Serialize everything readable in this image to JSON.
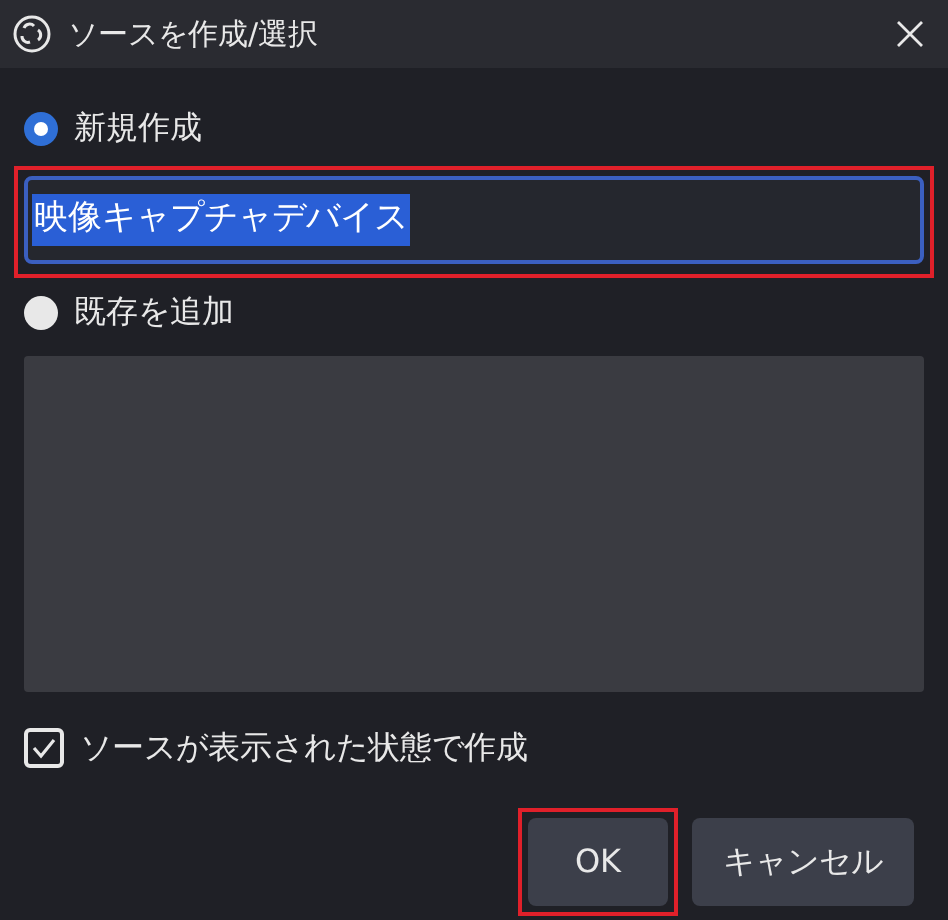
{
  "window": {
    "title": "ソースを作成/選択"
  },
  "options": [
    {
      "label": "新規作成",
      "selected": true
    },
    {
      "label": "既存を追加",
      "selected": false
    }
  ],
  "name_field": {
    "value": "映像キャプチャデバイス",
    "text_selected": true,
    "highlighted": true
  },
  "visible_checkbox": {
    "label": "ソースが表示された状態で作成",
    "checked": true
  },
  "buttons": [
    {
      "label": "OK",
      "highlighted": true
    },
    {
      "label": "キャンセル",
      "highlighted": false
    }
  ]
}
